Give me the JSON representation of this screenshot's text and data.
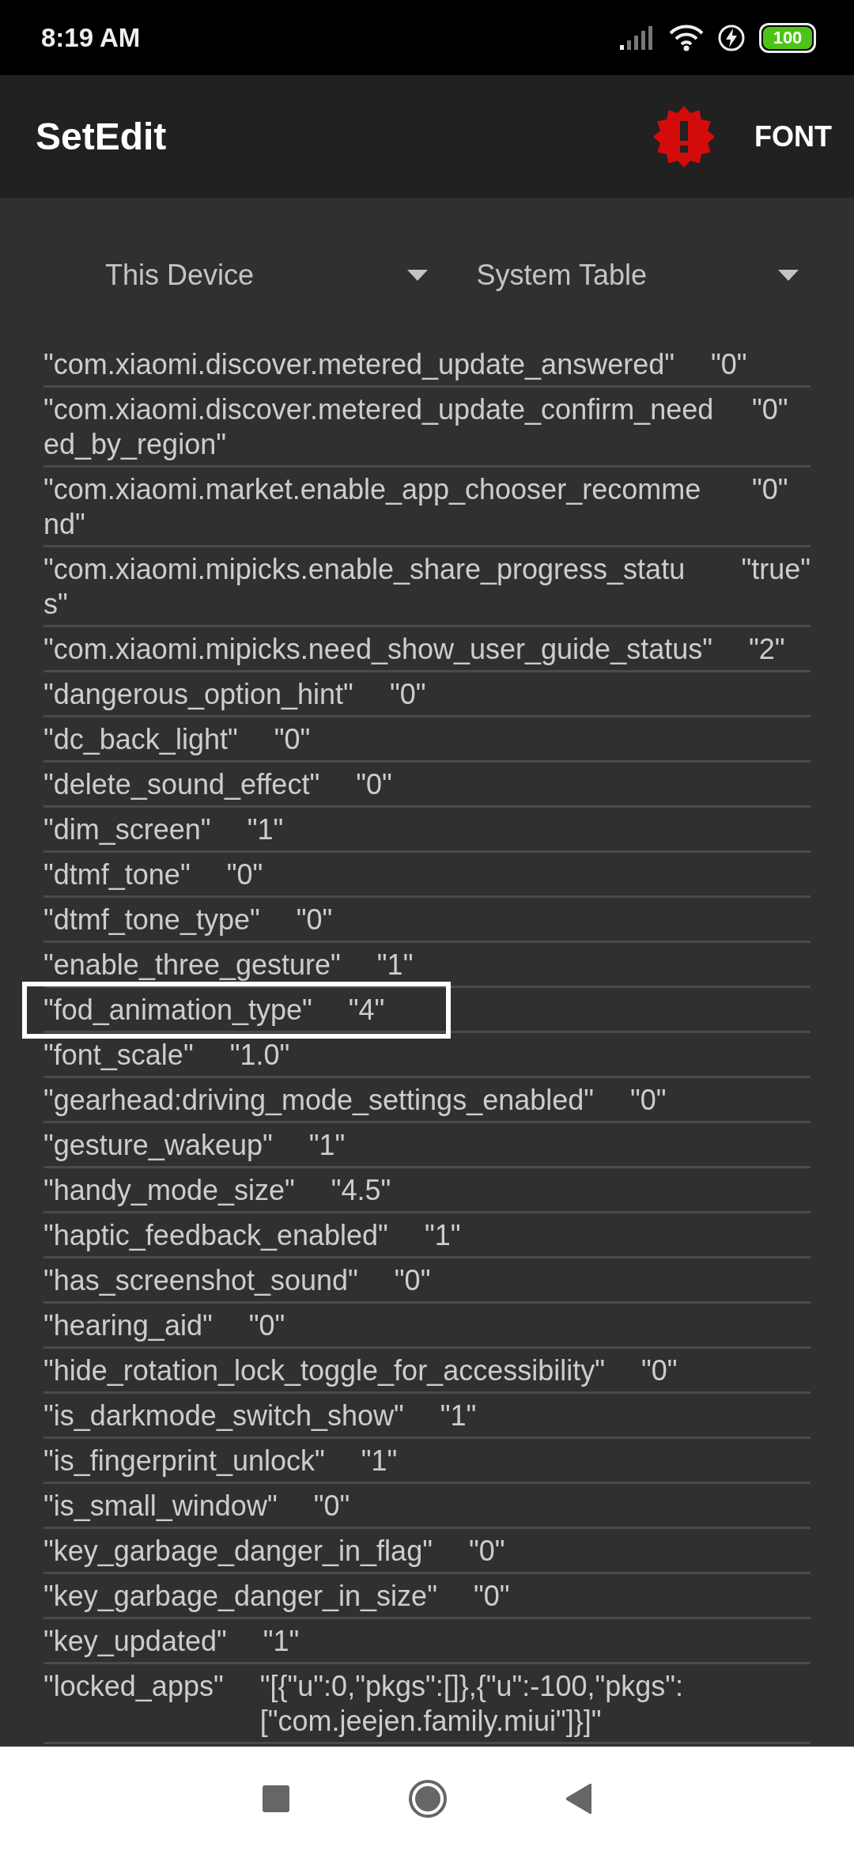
{
  "status_bar": {
    "time": "8:19 AM",
    "battery": "100"
  },
  "app_bar": {
    "title": "SetEdit",
    "action": "FONT"
  },
  "spinners": [
    {
      "label": "This Device"
    },
    {
      "label": "System Table"
    }
  ],
  "rows": [
    {
      "key": "\"com.xiaomi.discover.metered_update_answered\"",
      "value": "\"0\"",
      "highlighted": false
    },
    {
      "key": "\"com.xiaomi.discover.metered_update_confirm_needed_by_region\"",
      "value": "\"0\"",
      "highlighted": false
    },
    {
      "key": "\"com.xiaomi.market.enable_app_chooser_recommend\"",
      "value": "\"0\"",
      "highlighted": false
    },
    {
      "key": "\"com.xiaomi.mipicks.enable_share_progress_status\"",
      "value": "\"true\"",
      "highlighted": false
    },
    {
      "key": "\"com.xiaomi.mipicks.need_show_user_guide_status\"",
      "value": "\"2\"",
      "highlighted": false
    },
    {
      "key": "\"dangerous_option_hint\"",
      "value": "\"0\"",
      "highlighted": false
    },
    {
      "key": "\"dc_back_light\"",
      "value": "\"0\"",
      "highlighted": false
    },
    {
      "key": "\"delete_sound_effect\"",
      "value": "\"0\"",
      "highlighted": false
    },
    {
      "key": "\"dim_screen\"",
      "value": "\"1\"",
      "highlighted": false
    },
    {
      "key": "\"dtmf_tone\"",
      "value": "\"0\"",
      "highlighted": false
    },
    {
      "key": "\"dtmf_tone_type\"",
      "value": "\"0\"",
      "highlighted": false
    },
    {
      "key": "\"enable_three_gesture\"",
      "value": "\"1\"",
      "highlighted": false
    },
    {
      "key": "\"fod_animation_type\"",
      "value": "\"4\"",
      "highlighted": true
    },
    {
      "key": "\"font_scale\"",
      "value": "\"1.0\"",
      "highlighted": false
    },
    {
      "key": "\"gearhead:driving_mode_settings_enabled\"",
      "value": "\"0\"",
      "highlighted": false
    },
    {
      "key": "\"gesture_wakeup\"",
      "value": "\"1\"",
      "highlighted": false
    },
    {
      "key": "\"handy_mode_size\"",
      "value": "\"4.5\"",
      "highlighted": false
    },
    {
      "key": "\"haptic_feedback_enabled\"",
      "value": "\"1\"",
      "highlighted": false
    },
    {
      "key": "\"has_screenshot_sound\"",
      "value": "\"0\"",
      "highlighted": false
    },
    {
      "key": "\"hearing_aid\"",
      "value": "\"0\"",
      "highlighted": false
    },
    {
      "key": "\"hide_rotation_lock_toggle_for_accessibility\"",
      "value": "\"0\"",
      "highlighted": false
    },
    {
      "key": "\"is_darkmode_switch_show\"",
      "value": "\"1\"",
      "highlighted": false
    },
    {
      "key": "\"is_fingerprint_unlock\"",
      "value": "\"1\"",
      "highlighted": false
    },
    {
      "key": "\"is_small_window\"",
      "value": "\"0\"",
      "highlighted": false
    },
    {
      "key": "\"key_garbage_danger_in_flag\"",
      "value": "\"0\"",
      "highlighted": false
    },
    {
      "key": "\"key_garbage_danger_in_size\"",
      "value": "\"0\"",
      "highlighted": false
    },
    {
      "key": "\"key_updated\"",
      "value": "\"1\"",
      "highlighted": false
    },
    {
      "key": "\"locked_apps\"",
      "value": "\"[{\"u\":0,\"pkgs\":[]},{\"u\":-100,\"pkgs\":[\"com.jeejen.family.miui\"]}]\"",
      "highlighted": false
    }
  ]
}
